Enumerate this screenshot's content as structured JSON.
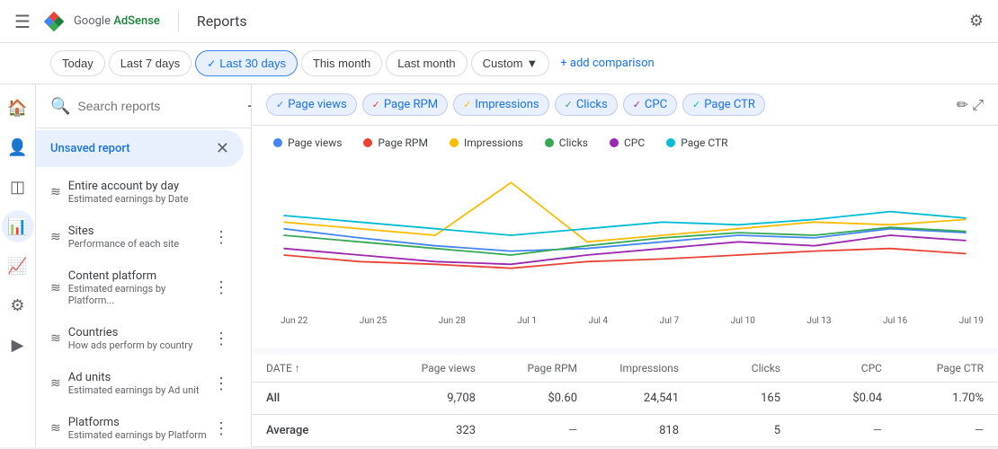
{
  "topbar": {
    "menu_icon": "☰",
    "logo_text": "Google ",
    "logo_product": "AdSense",
    "page_title": "Reports",
    "settings_icon": "⚙"
  },
  "filters": {
    "today": "Today",
    "last7": "Last 7 days",
    "last30": "Last 30 days",
    "thisMonth": "This month",
    "lastMonth": "Last month",
    "custom": "Custom",
    "custom_arrow": "▼",
    "add_comparison": "+ add comparison"
  },
  "sidebar": {
    "search_placeholder": "Search reports",
    "add_icon": "+",
    "unsaved_label": "Unsaved report",
    "items": [
      {
        "title": "Entire account by day",
        "subtitle": "Estimated earnings by Date",
        "icon": "≋",
        "hasMore": false
      },
      {
        "title": "Sites",
        "subtitle": "Performance of each site",
        "icon": "≋",
        "hasMore": true
      },
      {
        "title": "Content platform",
        "subtitle": "Estimated earnings by Platform...",
        "icon": "≋",
        "hasMore": true
      },
      {
        "title": "Countries",
        "subtitle": "How ads perform by country",
        "icon": "≋",
        "hasMore": true
      },
      {
        "title": "Ad units",
        "subtitle": "Estimated earnings by Ad unit",
        "icon": "≋",
        "hasMore": true
      },
      {
        "title": "Platforms",
        "subtitle": "Estimated earnings by Platform",
        "icon": "≋",
        "hasMore": true
      }
    ]
  },
  "metrics": {
    "chips": [
      {
        "label": "Page views",
        "color": "#4285f4"
      },
      {
        "label": "Page RPM",
        "color": "#ea4335"
      },
      {
        "label": "Impressions",
        "color": "#fbbc04"
      },
      {
        "label": "Clicks",
        "color": "#34a853"
      },
      {
        "label": "CPC",
        "color": "#9c27b0"
      },
      {
        "label": "Page CTR",
        "color": "#00bcd4"
      }
    ]
  },
  "legend": [
    {
      "label": "Page views",
      "color": "#4285f4"
    },
    {
      "label": "Page RPM",
      "color": "#ea4335"
    },
    {
      "label": "Impressions",
      "color": "#fbbc04"
    },
    {
      "label": "Clicks",
      "color": "#34a853"
    },
    {
      "label": "CPC",
      "color": "#9c27b0"
    },
    {
      "label": "Page CTR",
      "color": "#00bcd4"
    }
  ],
  "chart": {
    "x_labels": [
      "Jun 22",
      "Jun 25",
      "Jun 28",
      "Jul 1",
      "Jul 4",
      "Jul 7",
      "Jul 10",
      "Jul 13",
      "Jul 16",
      "Jul 19"
    ],
    "series": {
      "page_views": [
        55,
        48,
        42,
        38,
        40,
        45,
        50,
        48,
        55,
        52
      ],
      "page_rpm": [
        35,
        30,
        28,
        25,
        30,
        32,
        35,
        38,
        40,
        36
      ],
      "impressions": [
        60,
        55,
        50,
        90,
        45,
        50,
        55,
        60,
        58,
        62
      ],
      "clicks": [
        50,
        45,
        40,
        35,
        42,
        48,
        52,
        50,
        56,
        53
      ],
      "cpc": [
        40,
        35,
        30,
        28,
        35,
        40,
        45,
        42,
        50,
        46
      ],
      "page_ctr": [
        65,
        60,
        55,
        50,
        55,
        60,
        58,
        62,
        68,
        63
      ]
    }
  },
  "table": {
    "columns": [
      "DATE ↑",
      "Page views",
      "Page RPM",
      "Impressions",
      "Clicks",
      "CPC",
      "Page CTR"
    ],
    "rows": [
      {
        "label": "All",
        "values": [
          "9,708",
          "$0.60",
          "24,541",
          "165",
          "$0.04",
          "1.70%"
        ]
      },
      {
        "label": "Average",
        "values": [
          "323",
          "—",
          "818",
          "5",
          "—",
          "—"
        ]
      }
    ]
  },
  "nav_icons": [
    "⊞",
    "👤",
    "◉",
    "📊",
    "📈",
    "⚙",
    "🎬"
  ]
}
